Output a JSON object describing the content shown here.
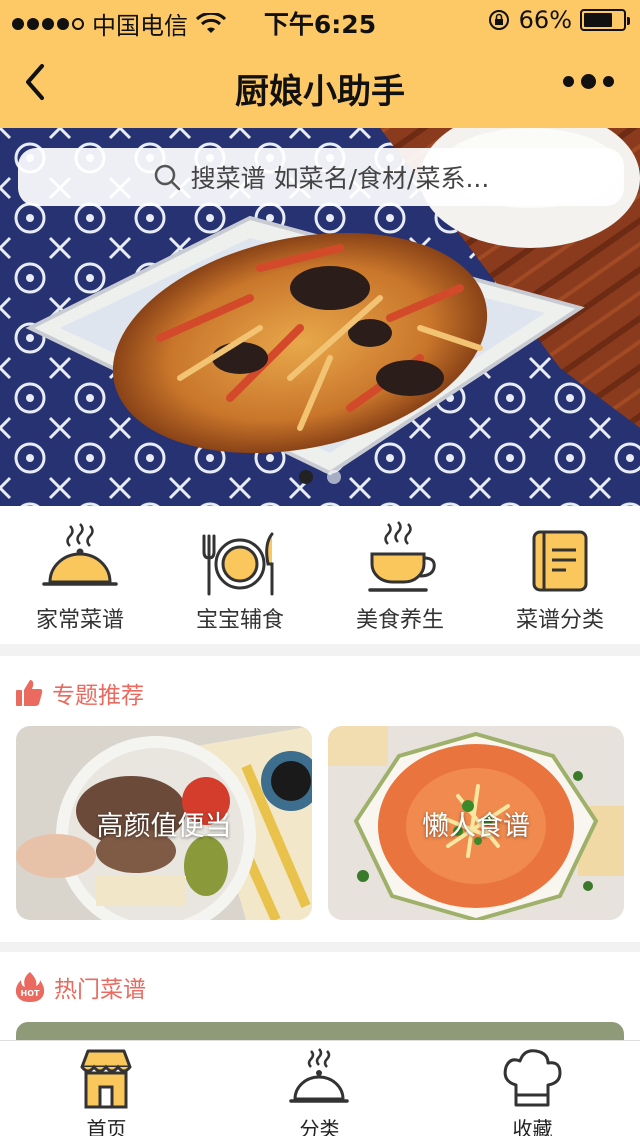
{
  "status_bar": {
    "carrier": "中国电信",
    "time": "下午6:25",
    "battery": "66%",
    "battery_level": 0.66
  },
  "nav": {
    "title": "厨娘小助手"
  },
  "search": {
    "placeholder": "搜菜谱 如菜名/食材/菜系..."
  },
  "banner": {
    "slide_count": 2,
    "active_slide": 1
  },
  "categories": [
    {
      "label": "家常菜谱",
      "icon": "cloche-icon"
    },
    {
      "label": "宝宝辅食",
      "icon": "plate-fork-knife-icon"
    },
    {
      "label": "美食养生",
      "icon": "cup-icon"
    },
    {
      "label": "菜谱分类",
      "icon": "recipe-book-icon"
    }
  ],
  "featured": {
    "title": "专题推荐",
    "cards": [
      {
        "title": "高颜值便当"
      },
      {
        "title": "懒人食谱"
      }
    ]
  },
  "hot": {
    "title": "热门菜谱",
    "badge": "HOT"
  },
  "tabbar": [
    {
      "label": "首页",
      "icon": "home-icon",
      "active": true
    },
    {
      "label": "分类",
      "icon": "cloche-icon",
      "active": false
    },
    {
      "label": "收藏",
      "icon": "chef-hat-icon",
      "active": false
    }
  ],
  "colors": {
    "accent": "#fdc966",
    "section_title": "#ea6a5f",
    "icon_fill": "#f9c75c"
  }
}
